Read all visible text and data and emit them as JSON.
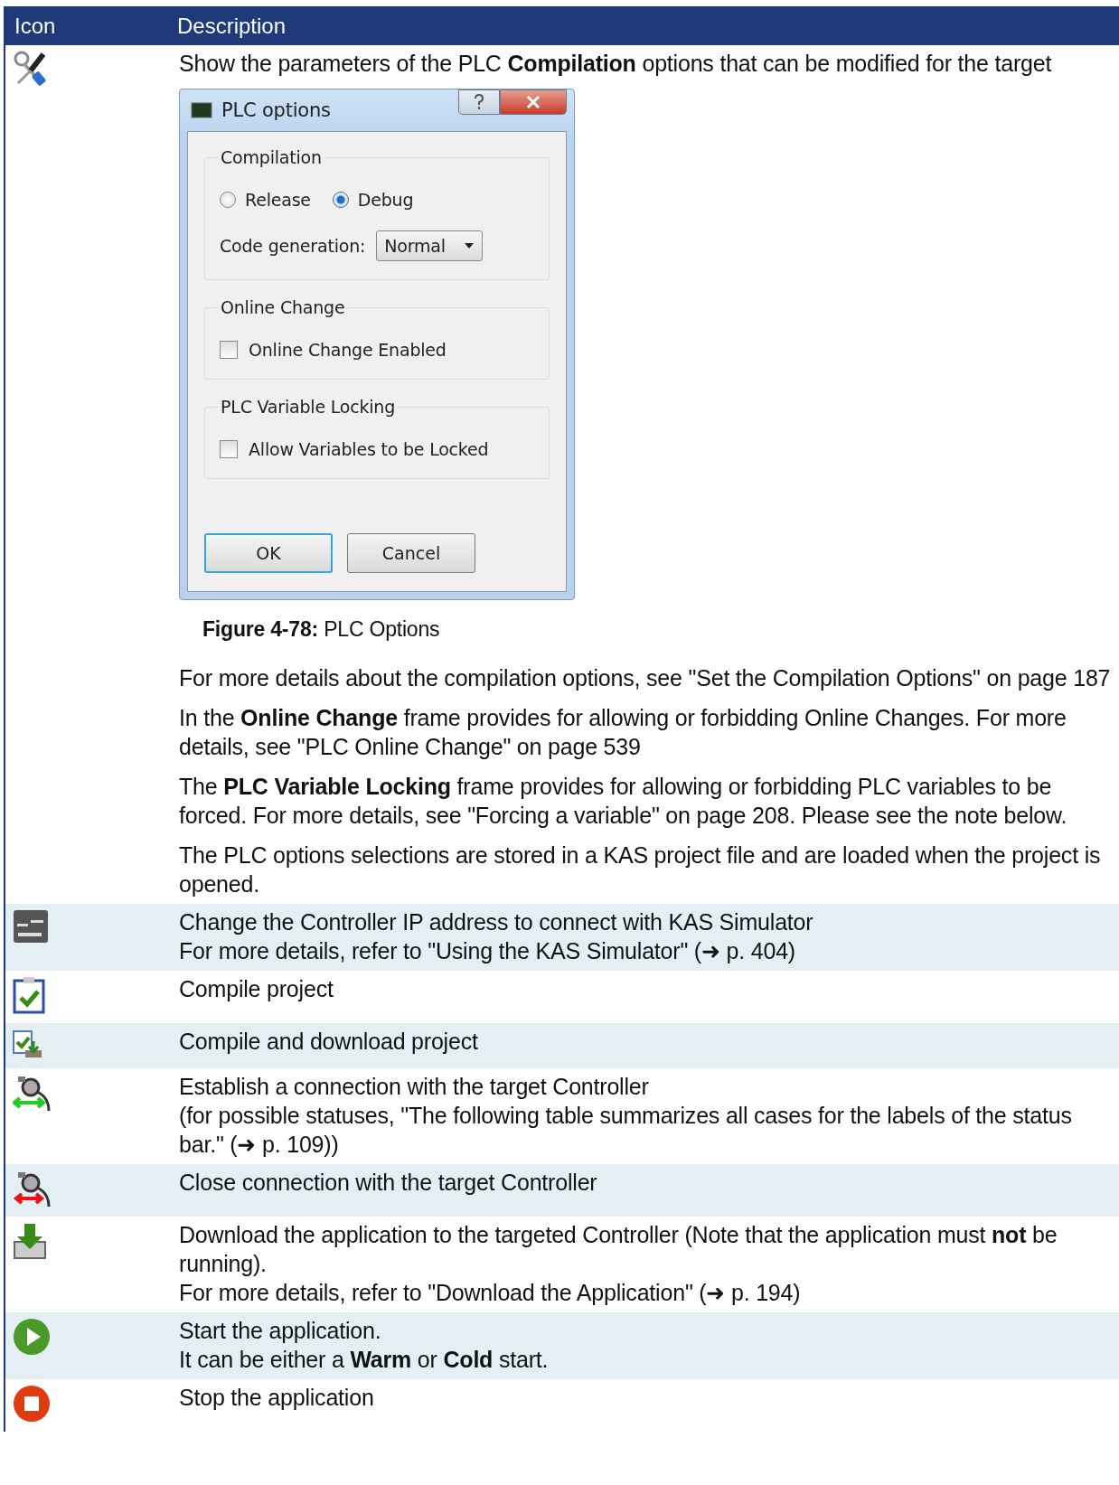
{
  "table": {
    "columns": [
      "Icon",
      "Description"
    ],
    "rows": [
      {
        "paragraphs": [
          [
            "Show the parameters of the PLC **Compilation** options that can be modified for the target"
          ]
        ],
        "dialog": {
          "title": "PLC options",
          "groups": [
            {
              "title": "Compilation",
              "controls": [
                {
                  "kind": "radios",
                  "options": [
                    {
                      "label": "Release",
                      "selected": false
                    },
                    {
                      "label": "Debug",
                      "selected": true
                    }
                  ]
                },
                {
                  "kind": "dropdown",
                  "label": "Code generation:",
                  "value": "Normal"
                }
              ]
            },
            {
              "title": "Online Change",
              "controls": [
                {
                  "kind": "checkbox",
                  "label": "Online Change Enabled",
                  "checked": false
                }
              ]
            },
            {
              "title": "PLC Variable Locking",
              "controls": [
                {
                  "kind": "checkbox",
                  "label": "Allow Variables to be Locked",
                  "checked": false
                }
              ]
            }
          ],
          "buttons": [
            {
              "label": "OK",
              "default": true
            },
            {
              "label": "Cancel",
              "default": false
            }
          ]
        },
        "caption": "**Figure 4-78:** PLC Options",
        "more": [
          [
            "For more details about the compilation options, see \"Set the Compilation Options\" on page 187"
          ],
          [
            "In the **Online Change** frame provides for allowing or forbidding Online Changes. For more details, see \"PLC Online Change\" on page 539"
          ],
          [
            "The **PLC Variable Locking** frame provides for allowing or forbidding PLC variables to be forced. For more details, see \"Forcing a variable\" on page 208. Please see the note below."
          ],
          [
            "The PLC options selections are stored in a KAS project file and are loaded when the project is opened."
          ]
        ]
      },
      {
        "paragraphs": [
          [
            "Change the Controller IP address to connect with KAS Simulator",
            "For more details, refer to \"Using the KAS Simulator\" (➜ p. 404)"
          ]
        ]
      },
      {
        "paragraphs": [
          [
            "Compile project"
          ]
        ]
      },
      {
        "paragraphs": [
          [
            "Compile and download project"
          ]
        ]
      },
      {
        "paragraphs": [
          [
            "Establish a connection with the target Controller",
            "(for possible statuses, \"The following table summarizes all cases for the labels of the status bar.\" (➜ p. 109))"
          ]
        ]
      },
      {
        "paragraphs": [
          [
            "Close connection with the target Controller"
          ]
        ]
      },
      {
        "paragraphs": [
          [
            "Download the application to the targeted Controller (Note that the application must **not** be running).",
            "For more details, refer to \"Download the Application\" (➜ p. 194)"
          ]
        ]
      },
      {
        "paragraphs": [
          [
            "Start the application.",
            "It can be either a **Warm** or **Cold** start."
          ]
        ]
      },
      {
        "paragraphs": [
          [
            "Stop the application"
          ]
        ]
      }
    ]
  }
}
